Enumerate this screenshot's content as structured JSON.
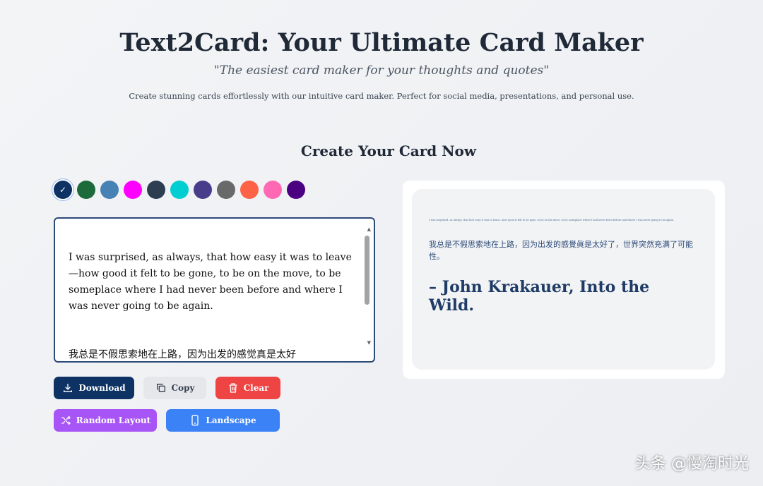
{
  "header": {
    "title": "Text2Card: Your Ultimate Card Maker",
    "subtitle": "\"The easiest card maker for your thoughts and quotes\"",
    "description": "Create stunning cards effortlessly with our intuitive card maker. Perfect for social media, presentations, and personal use."
  },
  "section_title": "Create Your Card Now",
  "colors": [
    "#0d3263",
    "#1d6a3b",
    "#4682b4",
    "#ff00ff",
    "#2c3e50",
    "#00ced1",
    "#483d8b",
    "#696969",
    "#ff6347",
    "#ff69b4",
    "#4b0082"
  ],
  "selected_color": "#0d3263",
  "editor": {
    "english": "I was surprised, as always, that how easy it was to leave—how good it felt to be gone, to be on the move, to be someplace where I had never been before and where I was never going to be again.",
    "chinese": "我总是不假思索地在上路，因为出发的感觉真是太好"
  },
  "buttons": {
    "download": "Download",
    "copy": "Copy",
    "clear": "Clear",
    "random": "Random Layout",
    "landscape": "Landscape"
  },
  "button_colors": {
    "download": "#0d3263",
    "copy": "#e5e7eb",
    "clear": "#ef4444",
    "random": "#a855f7",
    "landscape": "#3b82f6"
  },
  "preview": {
    "english": "I was surprised, as always, that how easy it was to leave—how good it felt to be gone, to be on the move, to be someplace where I had never been before and where I was never going to be again.",
    "chinese": "我总是不假思索地在上路，因为出发的感覺眞是太好了，世界突然充满了可能性。",
    "author": "– John Krakauer, Into the Wild."
  },
  "watermark": "头条 @慢淘时光"
}
